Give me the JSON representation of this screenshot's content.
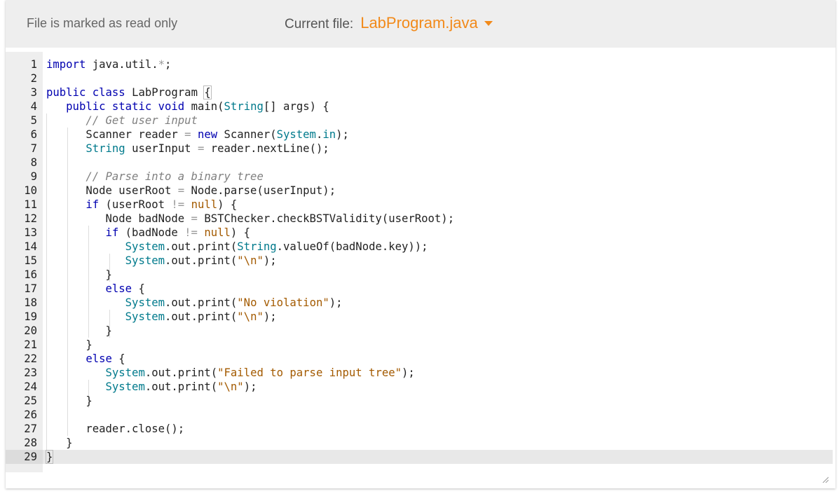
{
  "header": {
    "readonly_text": "File is marked as read only",
    "current_file_label": "Current file:",
    "current_file_name": "LabProgram.java",
    "accent_color": "#f28a1a"
  },
  "editor": {
    "active_line": 29,
    "lines": [
      {
        "n": "1",
        "segs": [
          [
            "kw",
            "import"
          ],
          [
            "",
            " java.util."
          ],
          [
            "op",
            "*"
          ],
          [
            "",
            ";"
          ]
        ]
      },
      {
        "n": "2",
        "segs": []
      },
      {
        "n": "3",
        "segs": [
          [
            "kw",
            "public"
          ],
          [
            "",
            " "
          ],
          [
            "kw",
            "class"
          ],
          [
            "",
            " LabProgram "
          ],
          [
            "bm",
            "{"
          ]
        ]
      },
      {
        "n": "4",
        "segs": [
          [
            "",
            "   "
          ],
          [
            "kw",
            "public"
          ],
          [
            "",
            " "
          ],
          [
            "kw",
            "static"
          ],
          [
            "",
            " "
          ],
          [
            "kw",
            "void"
          ],
          [
            "",
            " main("
          ],
          [
            "ty",
            "String"
          ],
          [
            "",
            "[] args) {"
          ]
        ]
      },
      {
        "n": "5",
        "segs": [
          [
            "",
            "      "
          ],
          [
            "cm",
            "// Get user input"
          ]
        ]
      },
      {
        "n": "6",
        "segs": [
          [
            "",
            "      Scanner reader "
          ],
          [
            "op",
            "="
          ],
          [
            "",
            " "
          ],
          [
            "kw",
            "new"
          ],
          [
            "",
            " Scanner("
          ],
          [
            "ty",
            "System"
          ],
          [
            "",
            "."
          ],
          [
            "ty",
            "in"
          ],
          [
            "",
            ");"
          ]
        ]
      },
      {
        "n": "7",
        "segs": [
          [
            "",
            "      "
          ],
          [
            "ty",
            "String"
          ],
          [
            "",
            " userInput "
          ],
          [
            "op",
            "="
          ],
          [
            "",
            " reader.nextLine();"
          ]
        ]
      },
      {
        "n": "8",
        "segs": []
      },
      {
        "n": "9",
        "segs": [
          [
            "",
            "      "
          ],
          [
            "cm",
            "// Parse into a binary tree"
          ]
        ]
      },
      {
        "n": "10",
        "segs": [
          [
            "",
            "      Node userRoot "
          ],
          [
            "op",
            "="
          ],
          [
            "",
            " Node.parse(userInput);"
          ]
        ]
      },
      {
        "n": "11",
        "segs": [
          [
            "",
            "      "
          ],
          [
            "kw",
            "if"
          ],
          [
            "",
            " (userRoot "
          ],
          [
            "op",
            "!="
          ],
          [
            "",
            " "
          ],
          [
            "str",
            "null"
          ],
          [
            "",
            ") {"
          ]
        ]
      },
      {
        "n": "12",
        "segs": [
          [
            "",
            "         Node badNode "
          ],
          [
            "op",
            "="
          ],
          [
            "",
            " BSTChecker.checkBSTValidity(userRoot);"
          ]
        ]
      },
      {
        "n": "13",
        "segs": [
          [
            "",
            "         "
          ],
          [
            "kw",
            "if"
          ],
          [
            "",
            " (badNode "
          ],
          [
            "op",
            "!="
          ],
          [
            "",
            " "
          ],
          [
            "str",
            "null"
          ],
          [
            "",
            ") {"
          ]
        ]
      },
      {
        "n": "14",
        "segs": [
          [
            "",
            "            "
          ],
          [
            "ty",
            "System"
          ],
          [
            "",
            ".out.print("
          ],
          [
            "ty",
            "String"
          ],
          [
            "",
            ".valueOf(badNode.key));"
          ]
        ]
      },
      {
        "n": "15",
        "segs": [
          [
            "",
            "            "
          ],
          [
            "ty",
            "System"
          ],
          [
            "",
            ".out.print("
          ],
          [
            "str",
            "\"\\n\""
          ],
          [
            "",
            ");"
          ]
        ]
      },
      {
        "n": "16",
        "segs": [
          [
            "",
            "         }"
          ]
        ]
      },
      {
        "n": "17",
        "segs": [
          [
            "",
            "         "
          ],
          [
            "kw",
            "else"
          ],
          [
            "",
            " {"
          ]
        ]
      },
      {
        "n": "18",
        "segs": [
          [
            "",
            "            "
          ],
          [
            "ty",
            "System"
          ],
          [
            "",
            ".out.print("
          ],
          [
            "str",
            "\"No violation\""
          ],
          [
            "",
            ");"
          ]
        ]
      },
      {
        "n": "19",
        "segs": [
          [
            "",
            "            "
          ],
          [
            "ty",
            "System"
          ],
          [
            "",
            ".out.print("
          ],
          [
            "str",
            "\"\\n\""
          ],
          [
            "",
            ");"
          ]
        ]
      },
      {
        "n": "20",
        "segs": [
          [
            "",
            "         }"
          ]
        ]
      },
      {
        "n": "21",
        "segs": [
          [
            "",
            "      }"
          ]
        ]
      },
      {
        "n": "22",
        "segs": [
          [
            "",
            "      "
          ],
          [
            "kw",
            "else"
          ],
          [
            "",
            " {"
          ]
        ]
      },
      {
        "n": "23",
        "segs": [
          [
            "",
            "         "
          ],
          [
            "ty",
            "System"
          ],
          [
            "",
            ".out.print("
          ],
          [
            "str",
            "\"Failed to parse input tree\""
          ],
          [
            "",
            ");"
          ]
        ]
      },
      {
        "n": "24",
        "segs": [
          [
            "",
            "         "
          ],
          [
            "ty",
            "System"
          ],
          [
            "",
            ".out.print("
          ],
          [
            "str",
            "\"\\n\""
          ],
          [
            "",
            ");"
          ]
        ]
      },
      {
        "n": "25",
        "segs": [
          [
            "",
            "      }"
          ]
        ]
      },
      {
        "n": "26",
        "segs": []
      },
      {
        "n": "27",
        "segs": [
          [
            "",
            "      reader.close();"
          ]
        ]
      },
      {
        "n": "28",
        "segs": [
          [
            "",
            "   }"
          ]
        ]
      },
      {
        "n": "29",
        "segs": [
          [
            "bm",
            "}"
          ]
        ]
      }
    ]
  },
  "icons": {
    "file_dropdown": "chevron-down-icon",
    "resize_handle": "resize-grip-icon"
  }
}
